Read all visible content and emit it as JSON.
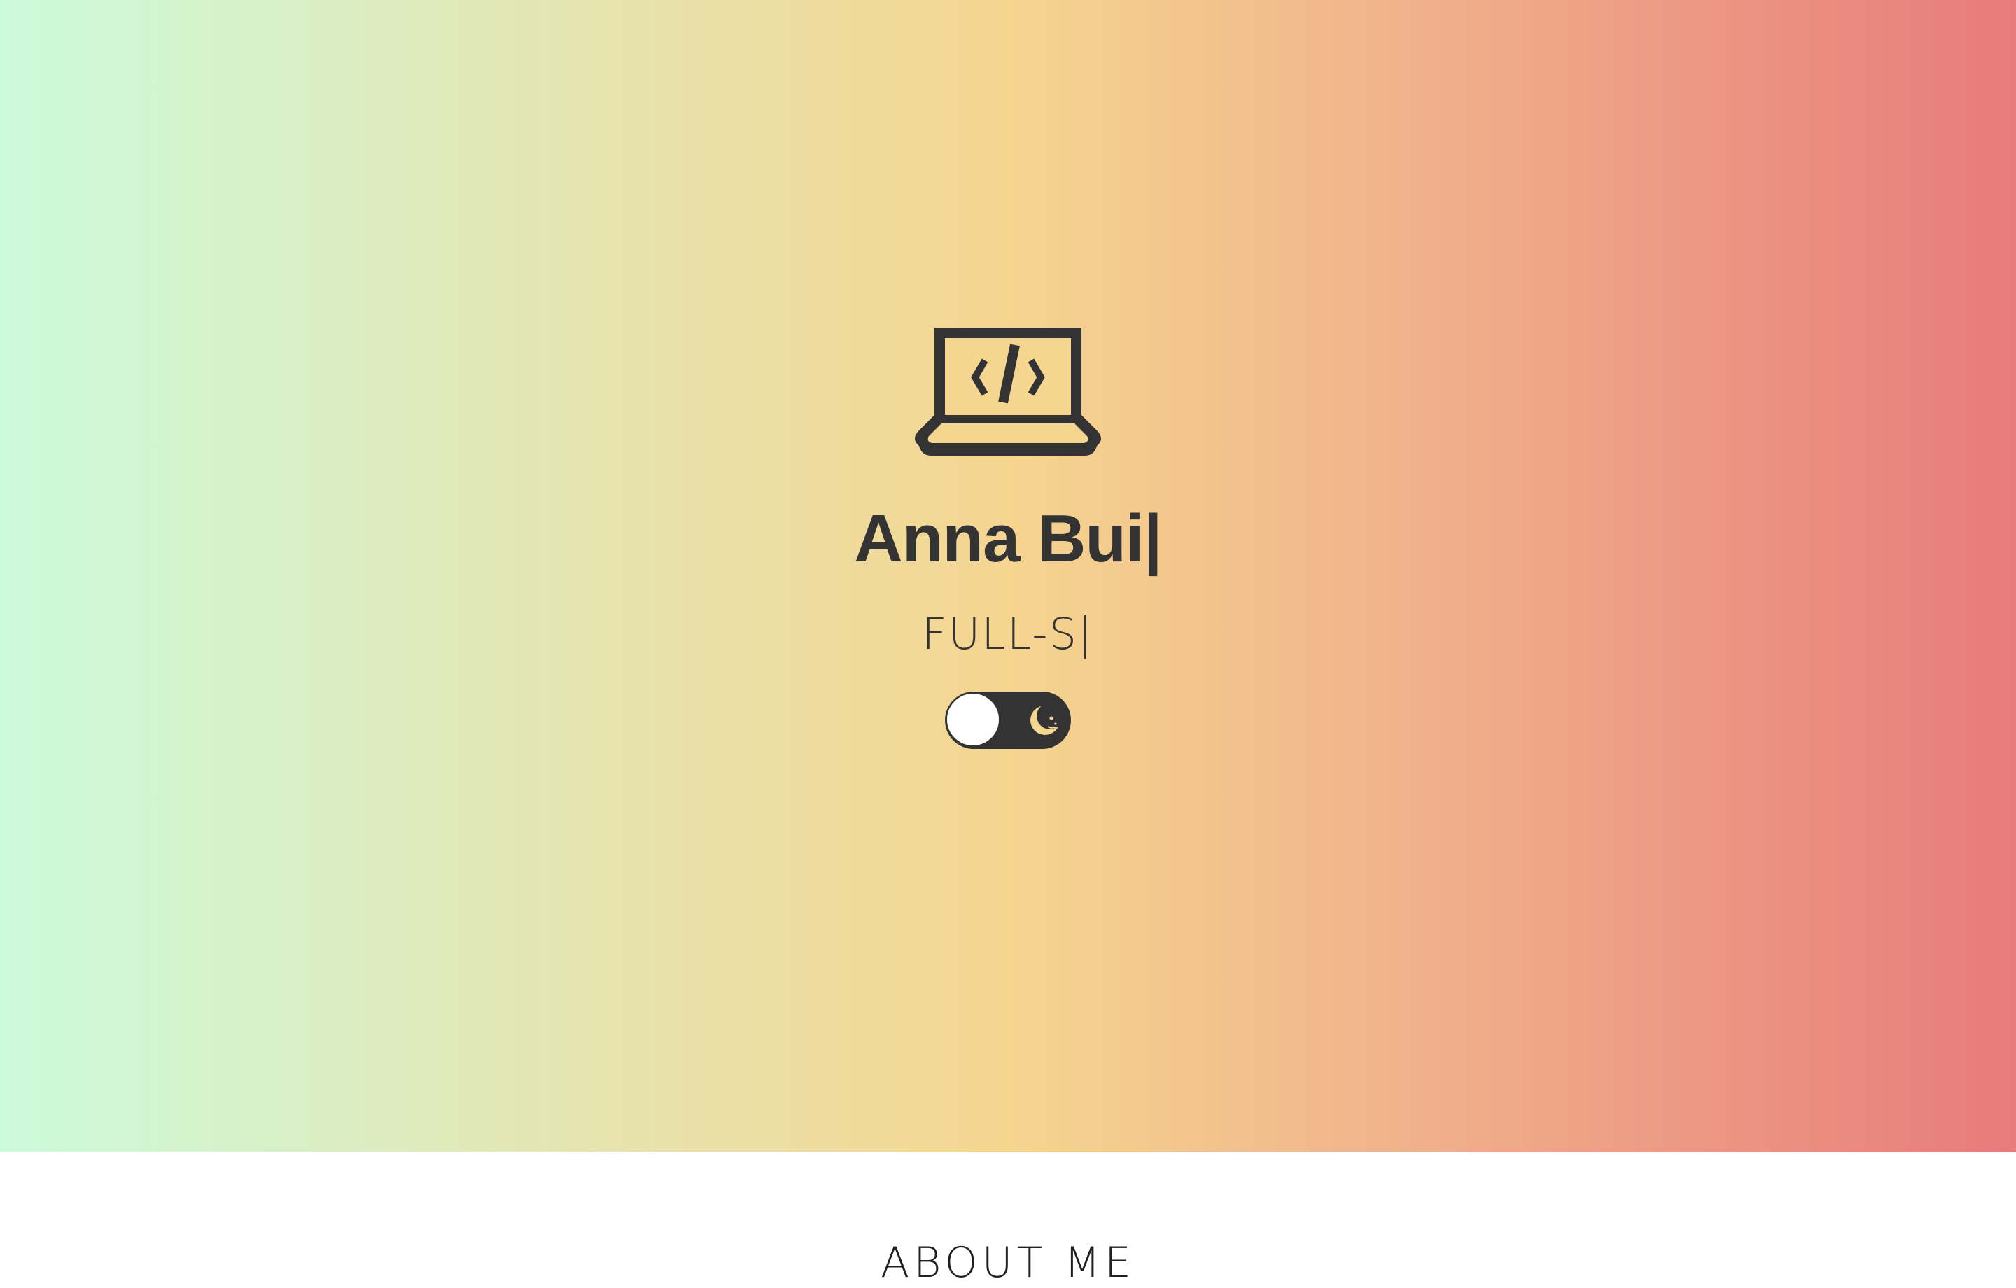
{
  "hero": {
    "name": "Anna Bui|",
    "role": "FULL-S|",
    "icon": "laptop-code-icon",
    "gradient_colors": [
      "#ccfbdc",
      "#e2e7b6",
      "#f5d590",
      "#f0ae8a",
      "#e77b7b"
    ]
  },
  "theme_toggle": {
    "icon": "moon-icon",
    "state": "light",
    "track_color": "#333333",
    "knob_color": "#ffffff"
  },
  "about": {
    "title": "ABOUT ME"
  }
}
